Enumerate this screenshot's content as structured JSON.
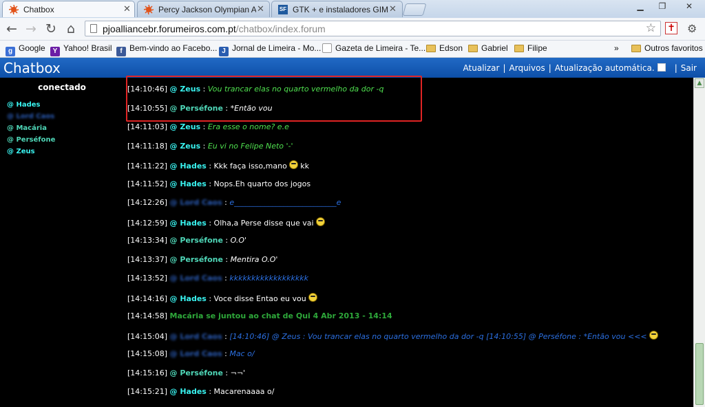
{
  "browser": {
    "tabs": [
      {
        "label": "Chatbox",
        "active": true
      },
      {
        "label": "Percy Jackson Olympian Allia",
        "active": false
      },
      {
        "label": "GTK + e instaladores GIMP p",
        "active": false,
        "icon_text": "SF"
      }
    ],
    "url_host": "pjoalliancebr.forumeiros.com.pt",
    "url_path": "/chatbox/index.forum",
    "bookmarks": [
      {
        "label": "Google",
        "icon": "google-icon",
        "color": "#3b6fd6",
        "icon_text": "g"
      },
      {
        "label": "Yahoo! Brasil",
        "icon": "yahoo-icon",
        "color": "#6b1ea5",
        "icon_text": "Y"
      },
      {
        "label": "Bem-vindo ao Facebo...",
        "icon": "facebook-icon",
        "color": "#3b5998",
        "icon_text": "f"
      },
      {
        "label": "Jornal de Limeira - Mo...",
        "icon": "news-icon",
        "color": "#2a5db0",
        "icon_text": "J"
      },
      {
        "label": "Gazeta de Limeira - Te...",
        "icon": "page-icon",
        "color": "#ffffff",
        "icon_text": ""
      },
      {
        "label": "Edson",
        "icon": "folder-icon"
      },
      {
        "label": "Gabriel",
        "icon": "folder-icon"
      },
      {
        "label": "Filipe",
        "icon": "folder-icon"
      }
    ],
    "more_bookmarks": "»",
    "other_bookmarks": "Outros favoritos"
  },
  "chatbox": {
    "title": "Chatbox",
    "links": [
      "Atualizar",
      "Arquivos",
      "Atualização automática.",
      "Sair"
    ]
  },
  "sidebar": {
    "heading": "conectado",
    "users": [
      {
        "name": "@ Hades",
        "color": "#39f3f0"
      },
      {
        "name": "@ Lord Caos",
        "color": "#2b5db8",
        "blurred": true
      },
      {
        "name": "@ Macária",
        "color": "#4fd7b8"
      },
      {
        "name": "@ Perséfone",
        "color": "#4fd7b8"
      },
      {
        "name": "@ Zeus",
        "color": "#39f3f0"
      }
    ]
  },
  "messages": [
    {
      "time": "[14:10:46]",
      "user": "@ Zeus",
      "user_color": "#39f3f0",
      "text": "Vou trancar elas no quarto vermelho da dor -q",
      "text_color": "#4fe04f",
      "italic": true
    },
    {
      "time": "[14:10:55]",
      "user": "@ Perséfone",
      "user_color": "#4fd7b8",
      "text": "*Então vou",
      "text_color": "#ffffff",
      "italic": true
    },
    {
      "time": "[14:11:03]",
      "user": "@ Zeus",
      "user_color": "#39f3f0",
      "text": "Era esse o nome? e.e",
      "text_color": "#4fe04f",
      "italic": true
    },
    {
      "time": "[14:11:18]",
      "user": "@ Zeus",
      "user_color": "#39f3f0",
      "text": "Eu vi no Felipe Neto '-'",
      "text_color": "#4fe04f",
      "italic": true
    },
    {
      "time": "[14:11:22]",
      "user": "@ Hades",
      "user_color": "#39f3f0",
      "text": "Kkk faça isso,mano",
      "text_color": "#ffffff",
      "italic": false,
      "emoji": "cool-emoji",
      "after": "kk"
    },
    {
      "time": "[14:11:52]",
      "user": "@ Hades",
      "user_color": "#39f3f0",
      "text": "Nops.Eh quarto dos jogos",
      "text_color": "#ffffff",
      "italic": false
    },
    {
      "time": "[14:12:26]",
      "user": "@ Lord Caos",
      "user_color": "#2b5db8",
      "blurred": true,
      "text": "e___________________________e",
      "text_color": "#2b6fe0",
      "italic": true
    },
    {
      "time": "[14:12:59]",
      "user": "@ Hades",
      "user_color": "#39f3f0",
      "text": "Olha,a Perse disse que vai",
      "text_color": "#ffffff",
      "italic": false,
      "emoji": "cool-emoji"
    },
    {
      "time": "[14:13:34]",
      "user": "@ Perséfone",
      "user_color": "#4fd7b8",
      "text": "O.O'",
      "text_color": "#ffffff",
      "italic": true
    },
    {
      "time": "[14:13:37]",
      "user": "@ Perséfone",
      "user_color": "#4fd7b8",
      "text": "Mentira O.O'",
      "text_color": "#ffffff",
      "italic": true
    },
    {
      "time": "[14:13:52]",
      "user": "@ Lord Caos",
      "user_color": "#2b5db8",
      "blurred": true,
      "text": "kkkkkkkkkkkkkkkkkk",
      "text_color": "#2b6fe0",
      "italic": true
    },
    {
      "time": "[14:14:16]",
      "user": "@ Hades",
      "user_color": "#39f3f0",
      "text": "Voce disse Entao eu vou",
      "text_color": "#ffffff",
      "italic": false,
      "emoji": "cool-emoji"
    },
    {
      "system": true,
      "time": "[14:14:58]",
      "text": "Macária se juntou ao chat de Qui 4 Abr 2013 - 14:14",
      "text_color": "#2ea83a"
    },
    {
      "time": "[14:15:04]",
      "user": "@ Lord Caos",
      "user_color": "#2b5db8",
      "blurred": true,
      "text": "[14:10:46] @ Zeus : Vou trancar elas no quarto vermelho da dor -q [14:10:55] @ Perséfone : *Então vou <<<",
      "text_color": "#2b6fe0",
      "italic": true,
      "emoji": "nerd-emoji"
    },
    {
      "time": "[14:15:08]",
      "user": "@ Lord Caos",
      "user_color": "#2b5db8",
      "blurred": true,
      "text": "Mac o/",
      "text_color": "#2b6fe0",
      "italic": true
    },
    {
      "time": "[14:15:16]",
      "user": "@ Perséfone",
      "user_color": "#4fd7b8",
      "text": "¬¬'",
      "text_color": "#ffffff",
      "italic": true
    },
    {
      "time": "[14:15:21]",
      "user": "@ Hades",
      "user_color": "#39f3f0",
      "text": "Macarenaaaa o/",
      "text_color": "#ffffff",
      "italic": false
    }
  ]
}
